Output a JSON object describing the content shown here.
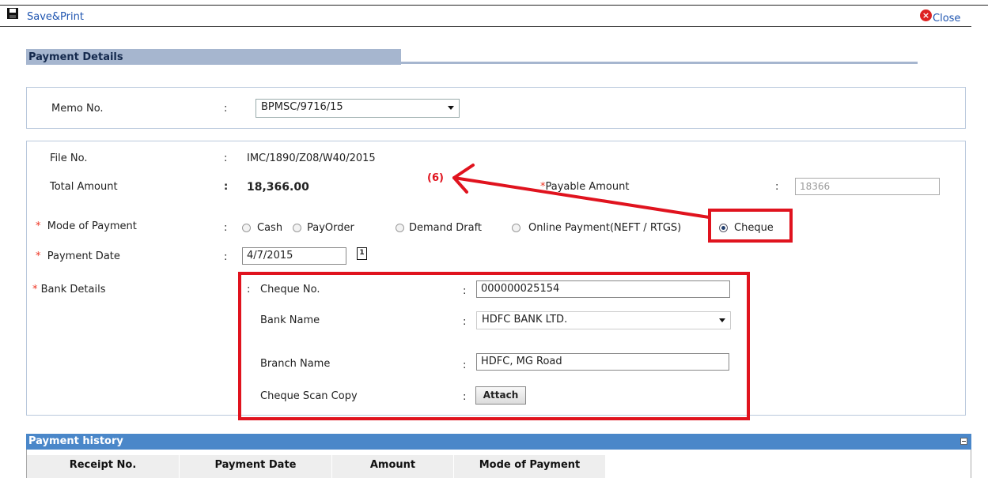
{
  "toolbar": {
    "save_print_label": "Save&Print",
    "close_label": "Close"
  },
  "section": {
    "title": "Payment Details"
  },
  "memo": {
    "label": "Memo No.",
    "colon": ":",
    "value": "BPMSC/9716/15"
  },
  "file_no": {
    "label": "File No.",
    "colon": ":",
    "value": "IMC/1890/Z08/W40/2015"
  },
  "total_amount": {
    "label": "Total Amount",
    "colon": ":",
    "value": "18,366.00"
  },
  "annotation": {
    "step_label": "(6)",
    "color": "#e0131e"
  },
  "payable_amount": {
    "required_mark": "*",
    "label": "Payable Amount",
    "colon": ":",
    "value": "18366"
  },
  "mode_of_payment": {
    "required_mark": "*",
    "label": "Mode of Payment",
    "colon": ":",
    "options": [
      "Cash",
      "PayOrder",
      "Demand Draft",
      "Online Payment(NEFT / RTGS)",
      "Cheque"
    ],
    "selected": "Cheque"
  },
  "payment_date": {
    "required_mark": "*",
    "label": "Payment Date",
    "colon": ":",
    "value": "4/7/2015",
    "calendar_glyph": "1"
  },
  "bank_details": {
    "required_mark": "*",
    "label": "Bank Details",
    "colon": ":",
    "cheque_no": {
      "label": "Cheque No.",
      "colon": ":",
      "value": "000000025154"
    },
    "bank_name": {
      "label": "Bank Name",
      "colon": ":",
      "value": "HDFC BANK LTD."
    },
    "branch_name": {
      "label": "Branch Name",
      "colon": ":",
      "value": "HDFC, MG Road"
    },
    "scan_copy": {
      "label": "Cheque Scan Copy",
      "colon": ":",
      "button_label": "Attach"
    }
  },
  "payment_history": {
    "title": "Payment history",
    "columns": [
      "Receipt No.",
      "Payment Date",
      "Amount",
      "Mode of Payment"
    ]
  }
}
